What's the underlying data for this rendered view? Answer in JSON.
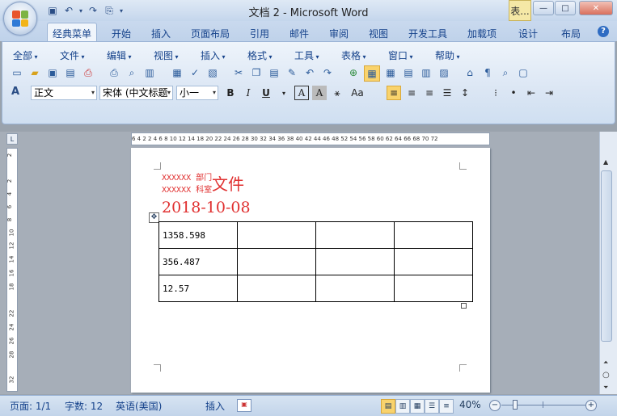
{
  "window": {
    "title": "文档 2 - Microsoft Word",
    "context_tab": "表...",
    "buttons": {
      "minimize": "—",
      "maximize": "□",
      "close": "✕"
    }
  },
  "quick_access": [
    {
      "name": "save-icon",
      "glyph": "💾"
    },
    {
      "name": "undo-icon",
      "glyph": "↶"
    },
    {
      "name": "redo-icon",
      "glyph": "↷"
    },
    {
      "name": "print-preview-icon",
      "glyph": "⎙"
    }
  ],
  "ribbon_tabs": [
    "经典菜单",
    "开始",
    "插入",
    "页面布局",
    "引用",
    "邮件",
    "审阅",
    "视图",
    "开发工具",
    "加载项",
    "设计",
    "布局"
  ],
  "active_tab": "经典菜单",
  "help_icon": "?",
  "menu_bar": [
    "全部",
    "文件",
    "编辑",
    "视图",
    "插入",
    "格式",
    "工具",
    "表格",
    "窗口",
    "帮助"
  ],
  "format_bar": {
    "style": "正文",
    "font": "宋体 (中文标题",
    "size": "小一",
    "bold": "B",
    "italic": "I",
    "underline": "U",
    "char_border": "A",
    "char_shading": "A",
    "char_scale": "Aa"
  },
  "document": {
    "dept_line1": "XXXXXX 部门",
    "dept_line2": "XXXXXX 科室",
    "title_suffix": "文件",
    "date": "2018-10-08",
    "table": [
      [
        "1358.598",
        "",
        "",
        ""
      ],
      [
        "356.487",
        "",
        "",
        ""
      ],
      [
        "12.57",
        "",
        "",
        ""
      ]
    ]
  },
  "rulers": {
    "horizontal": "6 4 2   2 4 6 8 10 12 14   18 20 22 24 26 28 30 32 34 36 38 40 42 44 46 48   52 54 56 58 60 62 64 66 68 70 72",
    "vertical": [
      "2",
      "2",
      "4",
      "6",
      "8",
      "10",
      "12",
      "14",
      "16",
      "18",
      "20",
      "22",
      "24",
      "26",
      "28",
      "30",
      "32"
    ],
    "corner": "L"
  },
  "status_bar": {
    "page": "页面: 1/1",
    "words": "字数: 12",
    "language": "英语(美国)",
    "insert_mode": "插入",
    "zoom": "40%",
    "zoom_level_percent": 40
  }
}
